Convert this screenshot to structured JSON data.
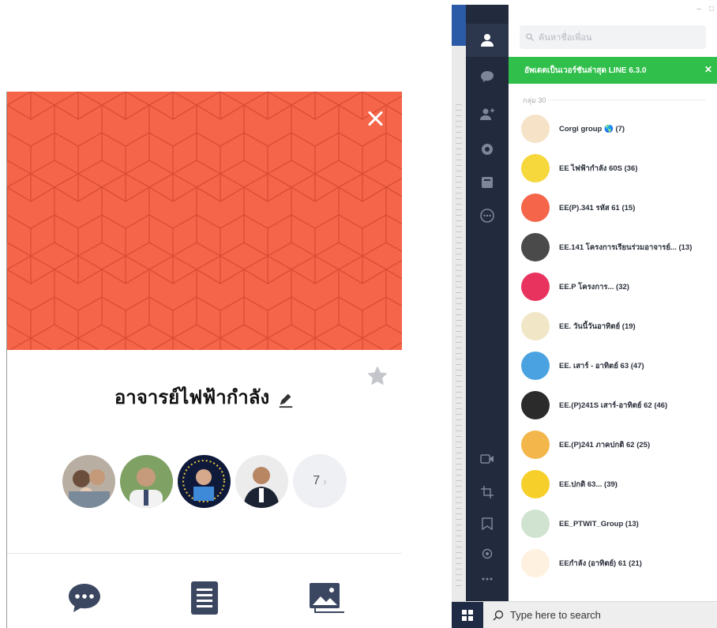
{
  "profile": {
    "group_name": "อาจารย์ไฟฟ้ากำลัง",
    "member_more_count": "7",
    "colors": {
      "cover": "#f4654a",
      "accent": "#3b4660"
    },
    "icons": [
      "close-icon",
      "star-icon",
      "edit-icon",
      "chat-icon",
      "notes-icon",
      "album-icon"
    ]
  },
  "line_app": {
    "search_placeholder": "ค้นหาชื่อเพื่อน",
    "update_banner": "อัพเดตเป็นเวอร์ชันล่าสุด LINE 6.3.0",
    "section_label": "กลุ่ม 30",
    "chats": [
      {
        "name": "Corgi group 🌎 (7)",
        "color": "#f6e3c7"
      },
      {
        "name": "EE ไฟฟ้ากำลัง 60S (36)",
        "color": "#f6d73c"
      },
      {
        "name": "EE(P).341 รหัส 61 (15)",
        "color": "#f4654a"
      },
      {
        "name": "EE.141 โครงการเรียนร่วมอาจารย์... (13)",
        "color": "#4a4a4a"
      },
      {
        "name": "EE.P โครงการ... (32)",
        "color": "#e8335f"
      },
      {
        "name": "EE. วันนี้วันอาทิตย์ (19)",
        "color": "#f1e6c6"
      },
      {
        "name": "EE. เสาร์ - อาทิตย์ 63 (47)",
        "color": "#4aa3e0"
      },
      {
        "name": "EE.(P)241S เสาร์-อาทิตย์ 62 (46)",
        "color": "#2b2b2b"
      },
      {
        "name": "EE.(P)241 ภาคปกติ 62 (25)",
        "color": "#f3b64a"
      },
      {
        "name": "EE.ปกติ 63... (39)",
        "color": "#f6cf2a"
      },
      {
        "name": "EE_PTWIT_Group (13)",
        "color": "#cfe3d0"
      },
      {
        "name": "EEกำลัง (อาทิตย์) 61 (21)",
        "color": "#fff1e0"
      }
    ]
  },
  "taskbar": {
    "search_text": "Type here to search"
  }
}
